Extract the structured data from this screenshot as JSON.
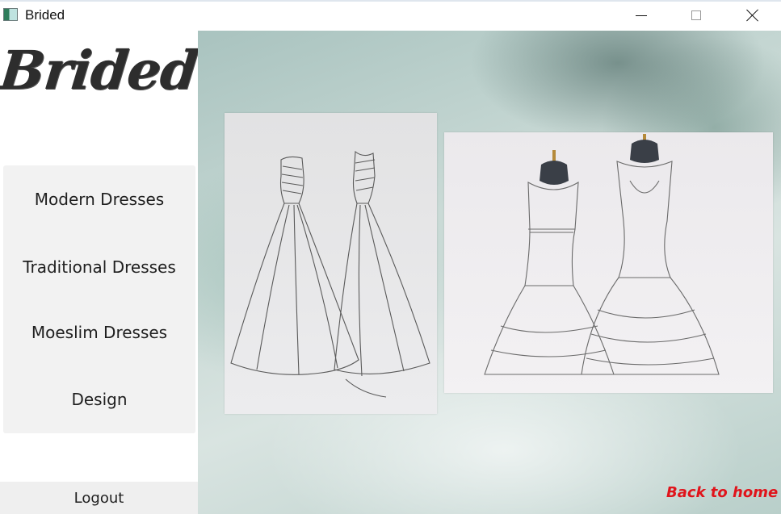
{
  "window": {
    "title": "Brided"
  },
  "sidebar": {
    "logo_text": "Brided",
    "menu": [
      {
        "label": "Modern Dresses"
      },
      {
        "label": "Traditional Dresses"
      },
      {
        "label": "Moeslim Dresses"
      },
      {
        "label": "Design"
      }
    ],
    "logout_label": "Logout"
  },
  "main": {
    "images": [
      {
        "icon": "wedding-dress-sketch-ballgown"
      },
      {
        "icon": "wedding-dress-sketch-mermaid"
      }
    ],
    "back_link_label": "Back to home",
    "back_link_color": "#e0141b"
  }
}
